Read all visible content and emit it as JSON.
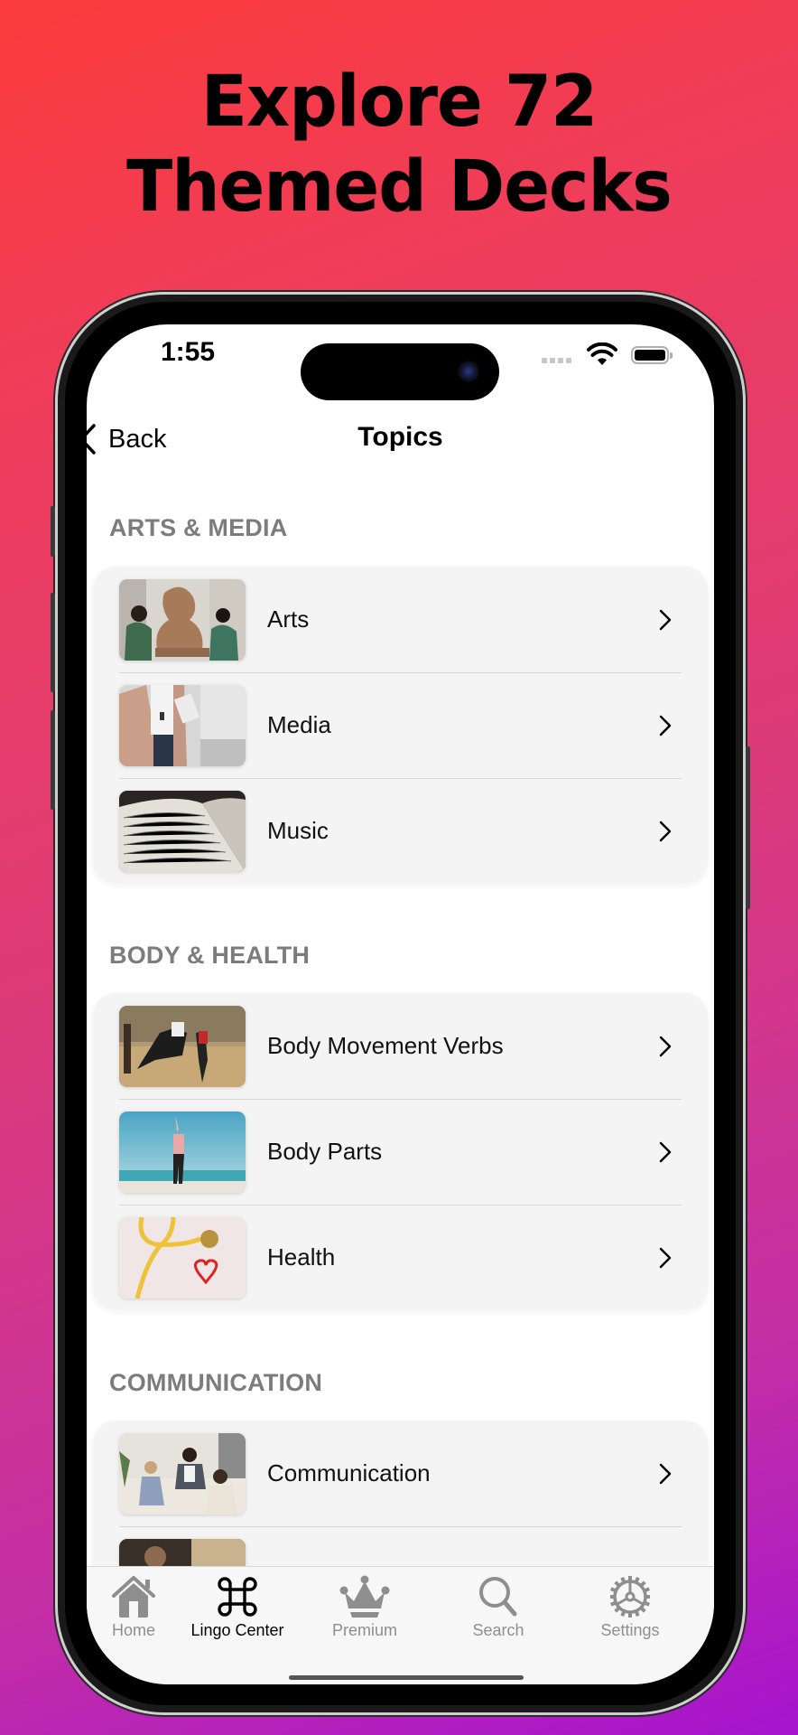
{
  "promo": {
    "title_line1": "Explore 72",
    "title_line2": "Themed Decks"
  },
  "status_bar": {
    "time": "1:55"
  },
  "nav": {
    "back_label": "Back",
    "title": "Topics"
  },
  "sections": [
    {
      "header": "ARTS & MEDIA",
      "items": [
        {
          "label": "Arts",
          "thumb": "sculpture-photo"
        },
        {
          "label": "Media",
          "thumb": "newspaper-photo"
        },
        {
          "label": "Music",
          "thumb": "sheet-music-photo"
        }
      ]
    },
    {
      "header": "BODY & HEALTH",
      "items": [
        {
          "label": "Body Movement Verbs",
          "thumb": "dance-class-photo"
        },
        {
          "label": "Body Parts",
          "thumb": "beach-stretch-photo"
        },
        {
          "label": "Health",
          "thumb": "stethoscope-photo"
        }
      ]
    },
    {
      "header": "COMMUNICATION",
      "items": [
        {
          "label": "Communication",
          "thumb": "friends-talking-photo"
        },
        {
          "label": "",
          "thumb": "partial-photo"
        }
      ]
    }
  ],
  "tabbar": {
    "tabs": [
      {
        "label": "Home",
        "icon": "house-icon",
        "active": false
      },
      {
        "label": "Lingo Center",
        "icon": "command-icon",
        "active": true
      },
      {
        "label": "Premium",
        "icon": "crown-icon",
        "active": false
      },
      {
        "label": "Search",
        "icon": "magnifier-icon",
        "active": false
      },
      {
        "label": "Settings",
        "icon": "gear-icon",
        "active": false
      }
    ]
  },
  "colors": {
    "gradient_start": "#fb3b3b",
    "gradient_end": "#a614cf",
    "section_header": "#7c7c7c",
    "card_bg": "#f4f4f4",
    "tab_inactive": "#8e8e8e",
    "tab_active": "#000000"
  }
}
